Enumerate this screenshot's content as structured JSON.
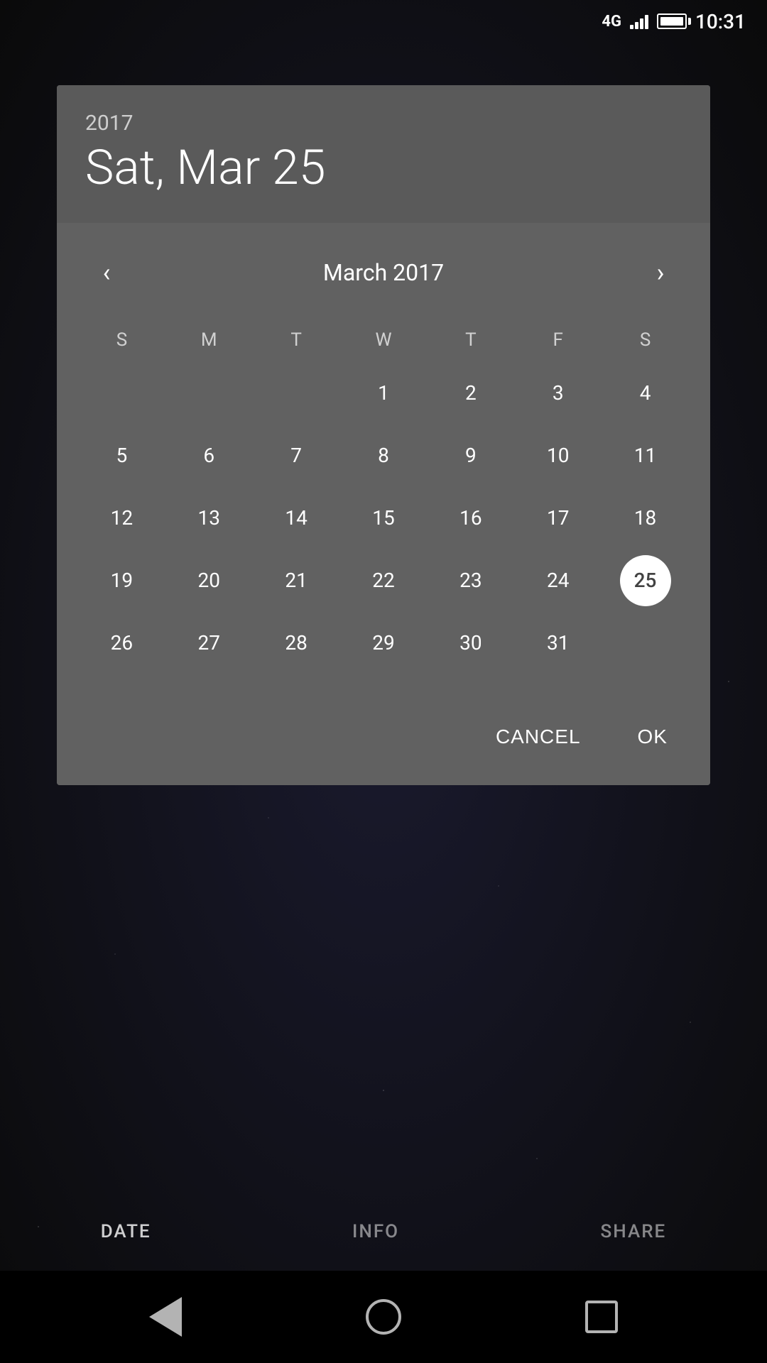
{
  "statusBar": {
    "network": "4G",
    "time": "10:31"
  },
  "dialog": {
    "year": "2017",
    "dateLabel": "Sat, Mar 25",
    "monthLabel": "March 2017",
    "selectedDay": 25,
    "dayHeaders": [
      "S",
      "M",
      "T",
      "W",
      "T",
      "F",
      "S"
    ],
    "firstDayOffset": 3,
    "daysInMonth": 31,
    "cancelLabel": "CANCEL",
    "okLabel": "OK"
  },
  "bottomTabs": [
    {
      "label": "DATE",
      "active": true
    },
    {
      "label": "INFO",
      "active": false
    },
    {
      "label": "SHARE",
      "active": false
    }
  ],
  "navBar": {
    "back": "back",
    "home": "home",
    "recents": "recents"
  }
}
